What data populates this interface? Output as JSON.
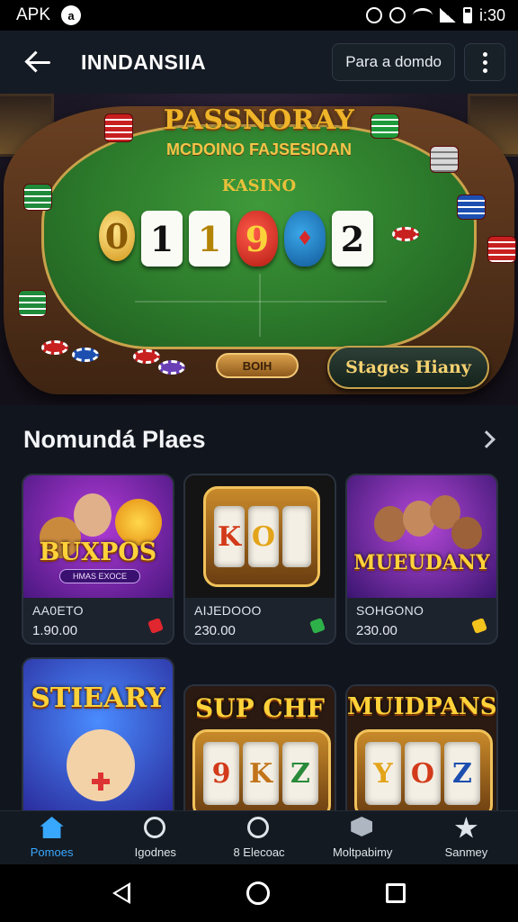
{
  "status_bar": {
    "carrier": "APK",
    "badge": "a",
    "time": "i:30"
  },
  "app_bar": {
    "title": "INNDANSIIA",
    "action_label": "Para a domdo"
  },
  "hero": {
    "title": "PASSNORAY",
    "subtitle": "MCDOINO FAJSESIOAN",
    "felt_label": "KASINO",
    "cards": [
      "0",
      "1",
      "1",
      "9",
      "",
      "2"
    ],
    "plaque": "BOIH",
    "cta_label": "Stages Hiany"
  },
  "section": {
    "title": "Nomundá Plaes"
  },
  "games": [
    {
      "art_title": "BUXPOS",
      "art_subtitle": "HMAS EXOCE",
      "name": "AA0ETO",
      "value": "1.90.00",
      "flag_color": "#e0262e"
    },
    {
      "art_title": "",
      "art_subtitle": "",
      "name": "AIJEDOOO",
      "value": "230.00",
      "flag_color": "#2fb14a"
    },
    {
      "art_title": "MUEUDANY",
      "art_subtitle": "",
      "name": "SOHGONO",
      "value": "230.00",
      "flag_color": "#f2c21d"
    },
    {
      "art_title": "STIEARY",
      "art_subtitle": "",
      "name": "",
      "value": "",
      "flag_color": ""
    },
    {
      "art_title": "SUP CHF",
      "art_subtitle": "",
      "name": "",
      "value": "",
      "flag_color": ""
    },
    {
      "art_title": "MUIDPANS",
      "art_subtitle": "",
      "name": "",
      "value": "",
      "flag_color": ""
    }
  ],
  "slot_reels": {
    "game2": [
      "K",
      "O",
      ""
    ],
    "game5": [
      "9",
      "K",
      "Z"
    ],
    "game6": [
      "Y",
      "O",
      "Z"
    ]
  },
  "bottom_nav": [
    {
      "label": "Pomoes",
      "icon": "home-icon",
      "active": true
    },
    {
      "label": "Igodnes",
      "icon": "search-icon",
      "active": false
    },
    {
      "label": "8 Elecoac",
      "icon": "chat-icon",
      "active": false
    },
    {
      "label": "Moltpabimy",
      "icon": "box-icon",
      "active": false
    },
    {
      "label": "Sanmey",
      "icon": "star-icon",
      "active": false
    }
  ],
  "colors": {
    "accent": "#38a8ff",
    "gold": "#f0b42a",
    "felt": "#2c7a2b"
  }
}
